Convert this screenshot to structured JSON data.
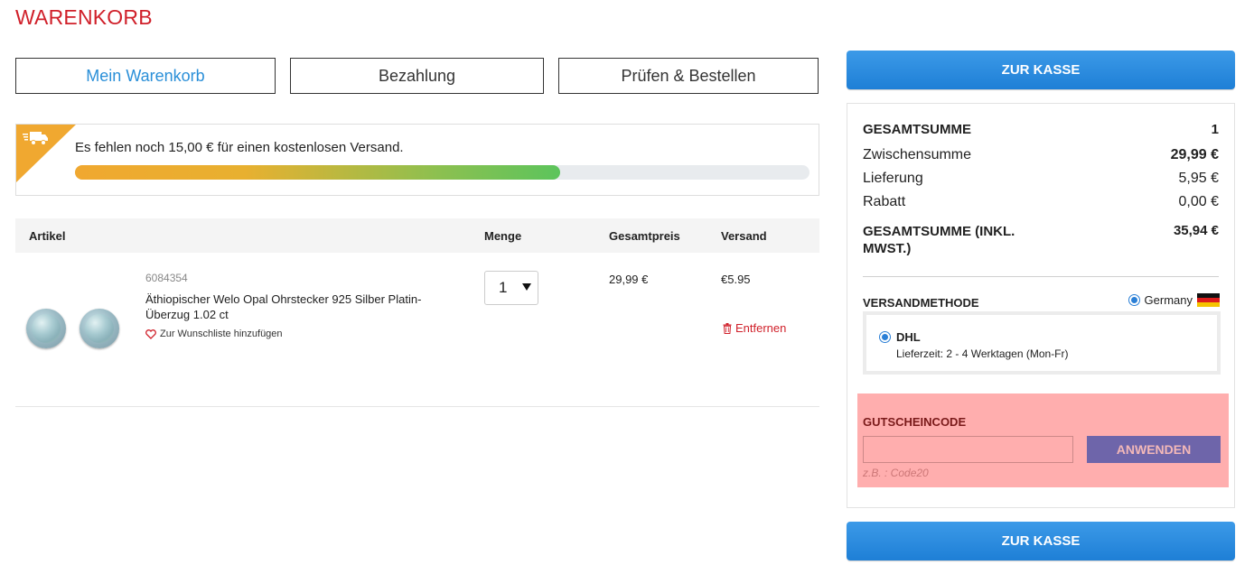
{
  "page": {
    "title": "WARENKORB"
  },
  "steps": [
    {
      "label": "Mein Warenkorb",
      "active": true
    },
    {
      "label": "Bezahlung",
      "active": false
    },
    {
      "label": "Prüfen & Bestellen",
      "active": false
    }
  ],
  "shipping_banner": {
    "message": "Es fehlen noch 15,00 € für einen kostenlosen Versand.",
    "progress": 0.66,
    "icon": "truck-icon"
  },
  "cart": {
    "columns": {
      "article": "Artikel",
      "quantity": "Menge",
      "total": "Gesamtpreis",
      "shipping": "Versand"
    },
    "items": [
      {
        "sku": "6084354",
        "name": "Äthiopischer Welo Opal Ohrstecker 925 Silber Platin-Überzug 1.02 ct",
        "wishlist_label": "Zur Wunschliste hinzufügen",
        "quantity": "1",
        "total": "29,99 €",
        "shipping": "€5.95",
        "remove_label": "Entfernen"
      }
    ]
  },
  "checkout": {
    "button_label": "ZUR KASSE"
  },
  "summary": {
    "total_label": "GESAMTSUMME",
    "total_count": "1",
    "subtotal_label": "Zwischensumme",
    "subtotal_value": "29,99 €",
    "delivery_label": "Lieferung",
    "delivery_value": "5,95 €",
    "discount_label": "Rabatt",
    "discount_value": "0,00 €",
    "grand_total_label": "GESAMTSUMME (INKL. MWST.)",
    "grand_total_value": "35,94 €"
  },
  "shipping_method": {
    "label": "VERSANDMETHODE",
    "country": "Germany",
    "carrier": "DHL",
    "delivery_time": "Lieferzeit: 2 - 4 Werktagen (Mon-Fr)"
  },
  "voucher": {
    "label": "GUTSCHEINCODE",
    "value": "",
    "button_label": "ANWENDEN",
    "hint": "z.B. : Code20"
  },
  "colors": {
    "brand_red": "#d0202a",
    "accent_blue": "#2a8fd8",
    "voucher_highlight": "#ffaeae"
  }
}
